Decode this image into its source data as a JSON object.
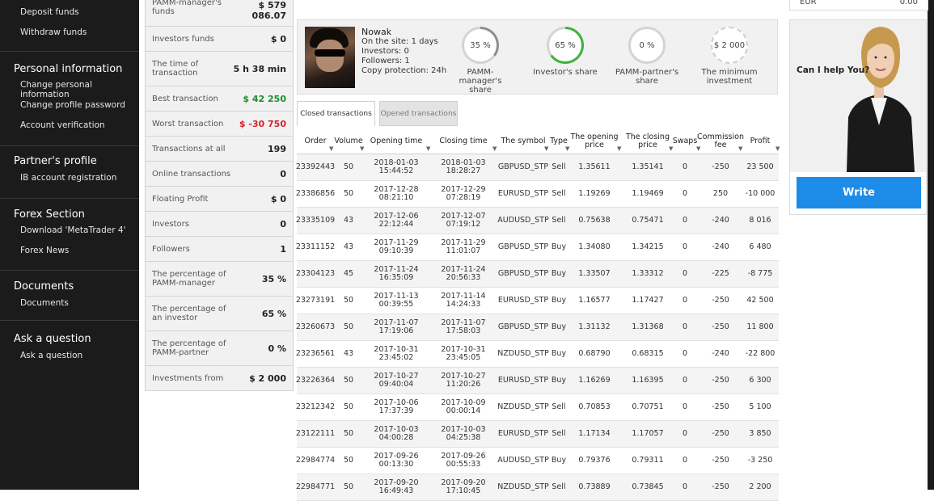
{
  "sidebar": {
    "sections": [
      {
        "title": "",
        "items": [
          "Deposit funds",
          "Withdraw funds"
        ]
      },
      {
        "title": "Personal information",
        "items": [
          "Change personal information",
          "Change profile password",
          "Account verification"
        ]
      },
      {
        "title": "Partner's profile",
        "items": [
          "IB account registration"
        ]
      },
      {
        "title": "Forex Section",
        "items": [
          "Download 'MetaTrader 4'",
          "Forex News"
        ]
      },
      {
        "title": "Documents",
        "items": [
          "Documents"
        ]
      },
      {
        "title": "Ask a question",
        "items": [
          "Ask a question"
        ]
      }
    ]
  },
  "stats": [
    {
      "label": "PAMM-manager's funds",
      "value": "$ 579 086.07",
      "tone": ""
    },
    {
      "label": "Investors funds",
      "value": "$ 0",
      "tone": ""
    },
    {
      "label": "The time of transaction",
      "value": "5 h 38 min",
      "tone": ""
    },
    {
      "label": "Best transaction",
      "value": "$ 42 250",
      "tone": "pos"
    },
    {
      "label": "Worst transaction",
      "value": "$ -30 750",
      "tone": "neg"
    },
    {
      "label": "Transactions at all",
      "value": "199",
      "tone": ""
    },
    {
      "label": "Online transactions",
      "value": "0",
      "tone": ""
    },
    {
      "label": "Floating Profit",
      "value": "$ 0",
      "tone": ""
    },
    {
      "label": "Investors",
      "value": "0",
      "tone": ""
    },
    {
      "label": "Followers",
      "value": "1",
      "tone": ""
    },
    {
      "label": "The percentage of PAMM-manager",
      "value": "35 %",
      "tone": ""
    },
    {
      "label": "The percentage of an investor",
      "value": "65 %",
      "tone": ""
    },
    {
      "label": "The percentage of PAMM-partner",
      "value": "0 %",
      "tone": ""
    },
    {
      "label": "Investments from",
      "value": "$ 2 000",
      "tone": ""
    }
  ],
  "profile": {
    "name": "Nowak",
    "lines": [
      "On the site: 1 days",
      "Investors: 0",
      "Followers: 1",
      "Copy protection: 24h"
    ]
  },
  "gauges": [
    {
      "value": "35 %",
      "label": "PAMM-manager's share",
      "fraction": 0.35,
      "color": "#8e8e8e"
    },
    {
      "value": "65 %",
      "label": "Investor's share",
      "fraction": 0.65,
      "color": "#3cb43c"
    },
    {
      "value": "0 %",
      "label": "PAMM-partner's share",
      "fraction": 0,
      "color": "#8e8e8e"
    },
    {
      "value": "$ 2 000",
      "label": "The minimum investment",
      "fraction": 0,
      "color": "#8e8e8e",
      "dashed": true
    }
  ],
  "tabs": {
    "closed": "Closed transactions",
    "opened": "Opened transactions"
  },
  "table": {
    "headers": [
      "Order",
      "Volume",
      "Opening time",
      "Closing time",
      "The symbol",
      "Type",
      "The opening price",
      "The closing price",
      "Swaps",
      "Commission fee",
      "Profit"
    ],
    "rows": [
      {
        "order": "23392443",
        "volume": "50",
        "open_date": "2018-01-03",
        "open_time": "15:44:52",
        "close_date": "2018-01-03",
        "close_time": "18:28:27",
        "symbol": "GBPUSD_STP",
        "type": "Sell",
        "open_price": "1.35611",
        "close_price": "1.35141",
        "swaps": "0",
        "fee": "-250",
        "profit": "23 500",
        "tone": "pos"
      },
      {
        "order": "23386856",
        "volume": "50",
        "open_date": "2017-12-28",
        "open_time": "08:21:10",
        "close_date": "2017-12-29",
        "close_time": "07:28:19",
        "symbol": "EURUSD_STP",
        "type": "Sell",
        "open_price": "1.19269",
        "close_price": "1.19469",
        "swaps": "0",
        "fee": "250",
        "profit": "-10 000",
        "tone": "neg"
      },
      {
        "order": "23335109",
        "volume": "43",
        "open_date": "2017-12-06",
        "open_time": "22:12:44",
        "close_date": "2017-12-07",
        "close_time": "07:19:12",
        "symbol": "AUDUSD_STP",
        "type": "Sell",
        "open_price": "0.75638",
        "close_price": "0.75471",
        "swaps": "0",
        "fee": "-240",
        "profit": "8 016",
        "tone": "pos"
      },
      {
        "order": "23311152",
        "volume": "43",
        "open_date": "2017-11-29",
        "open_time": "09:10:39",
        "close_date": "2017-11-29",
        "close_time": "11:01:07",
        "symbol": "GBPUSD_STP",
        "type": "Buy",
        "open_price": "1.34080",
        "close_price": "1.34215",
        "swaps": "0",
        "fee": "-240",
        "profit": "6 480",
        "tone": "pos"
      },
      {
        "order": "23304123",
        "volume": "45",
        "open_date": "2017-11-24",
        "open_time": "16:35:09",
        "close_date": "2017-11-24",
        "close_time": "20:56:33",
        "symbol": "GBPUSD_STP",
        "type": "Buy",
        "open_price": "1.33507",
        "close_price": "1.33312",
        "swaps": "0",
        "fee": "-225",
        "profit": "-8 775",
        "tone": "neg"
      },
      {
        "order": "23273191",
        "volume": "50",
        "open_date": "2017-11-13",
        "open_time": "00:39:55",
        "close_date": "2017-11-14",
        "close_time": "14:24:33",
        "symbol": "EURUSD_STP",
        "type": "Buy",
        "open_price": "1.16577",
        "close_price": "1.17427",
        "swaps": "0",
        "fee": "-250",
        "profit": "42 500",
        "tone": "pos"
      },
      {
        "order": "23260673",
        "volume": "50",
        "open_date": "2017-11-07",
        "open_time": "17:19:06",
        "close_date": "2017-11-07",
        "close_time": "17:58:03",
        "symbol": "GBPUSD_STP",
        "type": "Buy",
        "open_price": "1.31132",
        "close_price": "1.31368",
        "swaps": "0",
        "fee": "-250",
        "profit": "11 800",
        "tone": "pos"
      },
      {
        "order": "23236561",
        "volume": "43",
        "open_date": "2017-10-31",
        "open_time": "23:45:02",
        "close_date": "2017-10-31",
        "close_time": "23:45:05",
        "symbol": "NZDUSD_STP",
        "type": "Buy",
        "open_price": "0.68790",
        "close_price": "0.68315",
        "swaps": "0",
        "fee": "-240",
        "profit": "-22 800",
        "tone": "neg"
      },
      {
        "order": "23226364",
        "volume": "50",
        "open_date": "2017-10-27",
        "open_time": "09:40:04",
        "close_date": "2017-10-27",
        "close_time": "11:20:26",
        "symbol": "EURUSD_STP",
        "type": "Buy",
        "open_price": "1.16269",
        "close_price": "1.16395",
        "swaps": "0",
        "fee": "-250",
        "profit": "6 300",
        "tone": "pos"
      },
      {
        "order": "23212342",
        "volume": "50",
        "open_date": "2017-10-06",
        "open_time": "17:37:39",
        "close_date": "2017-10-09",
        "close_time": "00:00:14",
        "symbol": "NZDUSD_STP",
        "type": "Sell",
        "open_price": "0.70853",
        "close_price": "0.70751",
        "swaps": "0",
        "fee": "-250",
        "profit": "5 100",
        "tone": "pos"
      },
      {
        "order": "23122111",
        "volume": "50",
        "open_date": "2017-10-03",
        "open_time": "04:00:28",
        "close_date": "2017-10-03",
        "close_time": "04:25:38",
        "symbol": "EURUSD_STP",
        "type": "Sell",
        "open_price": "1.17134",
        "close_price": "1.17057",
        "swaps": "0",
        "fee": "-250",
        "profit": "3 850",
        "tone": "pos"
      },
      {
        "order": "22984774",
        "volume": "50",
        "open_date": "2017-09-26",
        "open_time": "00:13:30",
        "close_date": "2017-09-26",
        "close_time": "00:55:33",
        "symbol": "AUDUSD_STP",
        "type": "Buy",
        "open_price": "0.79376",
        "close_price": "0.79311",
        "swaps": "0",
        "fee": "-250",
        "profit": "-3 250",
        "tone": "neg"
      },
      {
        "order": "22984771",
        "volume": "50",
        "open_date": "2017-09-20",
        "open_time": "16:49:43",
        "close_date": "2017-09-20",
        "close_time": "17:10:45",
        "symbol": "NZDUSD_STP",
        "type": "Sell",
        "open_price": "0.73889",
        "close_price": "0.73845",
        "swaps": "0",
        "fee": "-250",
        "profit": "2 200",
        "tone": "pos"
      }
    ]
  },
  "top_right": {
    "currency": "EUR",
    "value": "0.00"
  },
  "help": {
    "question": "Can I help You?",
    "button": "Write"
  }
}
